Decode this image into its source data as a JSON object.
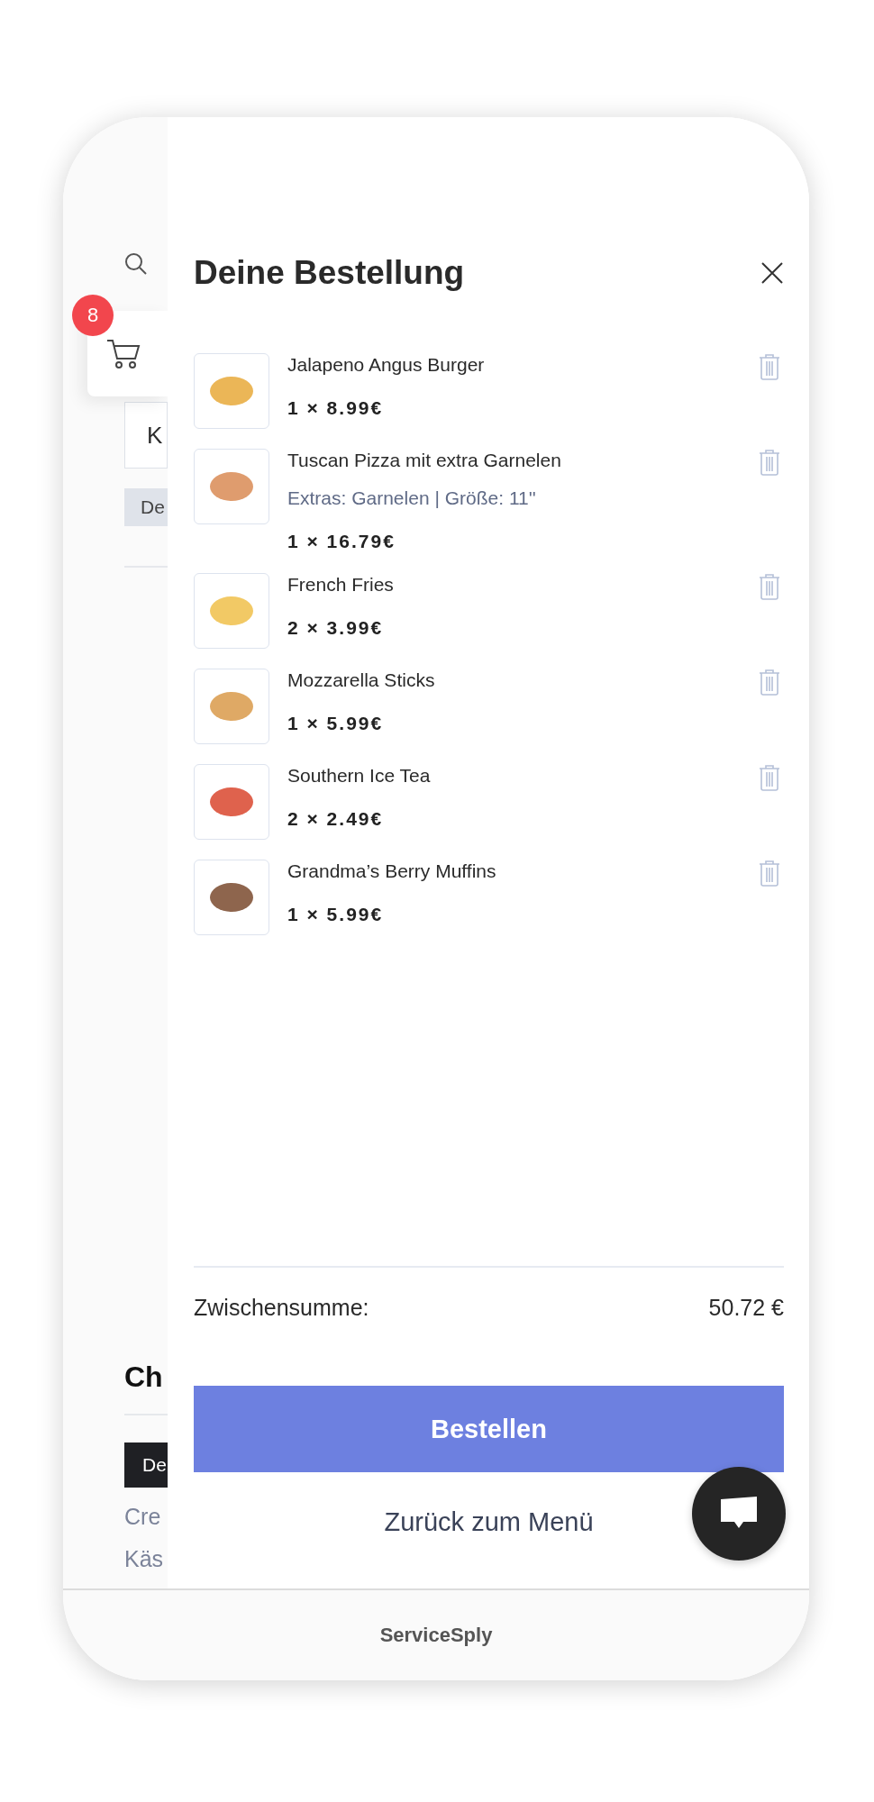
{
  "background_page": {
    "field_text": "K",
    "chip_top": "De",
    "heading": "Ch",
    "chip_dark": "De",
    "text_lines": [
      "Cre",
      "Käs"
    ]
  },
  "cart_tab": {
    "badge": "8"
  },
  "drawer": {
    "title": "Deine Bestellung",
    "items": [
      {
        "name": "Jalapeno Angus Burger",
        "quantity_price": "1 × 8.99€"
      },
      {
        "name": "Tuscan Pizza mit extra Garnelen",
        "extras": "Extras: Garnelen | Größe: 11''",
        "quantity_price": "1 × 16.79€"
      },
      {
        "name": "French Fries",
        "quantity_price": "2 × 3.99€"
      },
      {
        "name": "Mozzarella Sticks",
        "quantity_price": "1 × 5.99€"
      },
      {
        "name": "Southern Ice Tea",
        "quantity_price": "2 × 2.49€"
      },
      {
        "name": "Grandma’s Berry Muffins",
        "quantity_price": "1 × 5.99€"
      }
    ],
    "subtotal_label": "Zwischensumme:",
    "subtotal": "50.72 €",
    "order_button": "Bestellen",
    "back_link": "Zurück zum Menü"
  },
  "footer": {
    "brand": "ServiceSply"
  }
}
